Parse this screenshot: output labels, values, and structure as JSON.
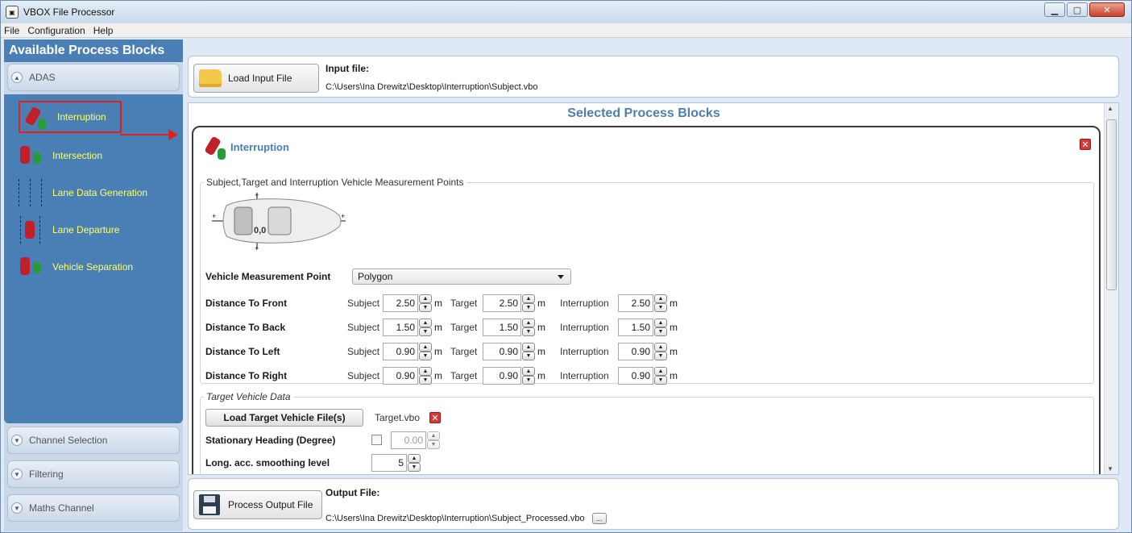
{
  "window": {
    "title": "VBOX File Processor",
    "icon": "vbox-app-icon"
  },
  "menu": [
    "File",
    "Configuration",
    "Help"
  ],
  "sidebar": {
    "title": "Available Process Blocks",
    "sections": {
      "adas": "ADAS",
      "channel_selection": "Channel Selection",
      "filtering": "Filtering",
      "maths_channel": "Maths Channel"
    },
    "items": [
      {
        "label": "Interruption",
        "selected": true
      },
      {
        "label": "Intersection"
      },
      {
        "label": "Lane Data Generation"
      },
      {
        "label": "Lane Departure"
      },
      {
        "label": "Vehicle Separation"
      }
    ]
  },
  "input": {
    "load_label": "Load Input File",
    "heading": "Input file:",
    "path": "C:\\Users\\Ina Drewitz\\Desktop\\Interruption\\Subject.vbo"
  },
  "main": {
    "title": "Selected Process Blocks",
    "block": {
      "title": "Interruption",
      "points_group": {
        "legend": "Subject,Target and Interruption Vehicle Measurement Points",
        "diagram_origin": "0,0",
        "vmp_label": "Vehicle Measurement Point",
        "vmp_value": "Polygon",
        "col_subject": "Subject",
        "col_target": "Target",
        "col_interruption": "Interruption",
        "unit": "m",
        "rows": [
          {
            "label": "Distance To Front",
            "subject": "2.50",
            "target": "2.50",
            "interruption": "2.50"
          },
          {
            "label": "Distance To Back",
            "subject": "1.50",
            "target": "1.50",
            "interruption": "1.50"
          },
          {
            "label": "Distance To Left",
            "subject": "0.90",
            "target": "0.90",
            "interruption": "0.90"
          },
          {
            "label": "Distance To Right",
            "subject": "0.90",
            "target": "0.90",
            "interruption": "0.90"
          }
        ]
      },
      "target_group": {
        "legend": "Target Vehicle Data",
        "load_btn": "Load Target Vehicle File(s)",
        "file": "Target.vbo",
        "stationary_label": "Stationary Heading (Degree)",
        "stationary_value": "0.00",
        "smoothing_label": "Long. acc. smoothing level",
        "smoothing_value": "5"
      }
    }
  },
  "output": {
    "btn_label": "Process Output File",
    "heading": "Output File:",
    "path": "C:\\Users\\Ina Drewitz\\Desktop\\Interruption\\Subject_Processed.vbo",
    "browse": "..."
  },
  "colors": {
    "accent": "#4a7fb5",
    "item_text": "#ffff66",
    "highlight": "#e02020"
  }
}
